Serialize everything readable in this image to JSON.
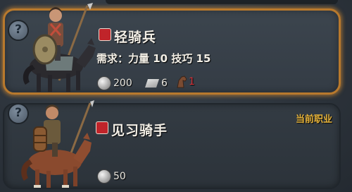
{
  "units": [
    {
      "name": "轻骑兵",
      "requirement": "需求：力量 10 技巧 15",
      "cost": "200",
      "iron": "6",
      "horses": "1",
      "selected": true
    },
    {
      "name": "见习骑手",
      "current_label": "当前职业",
      "cost": "50",
      "selected": false
    }
  ],
  "help_glyph": "?",
  "colors": {
    "highlight": "#e8962d",
    "current": "#e7b43b",
    "warn": "#d4333a"
  },
  "icons": {
    "help": "question-icon",
    "class": "horse-head-icon",
    "silver": "silver-coin-icon",
    "iron": "iron-ingot-icon",
    "horse": "horse-icon"
  }
}
